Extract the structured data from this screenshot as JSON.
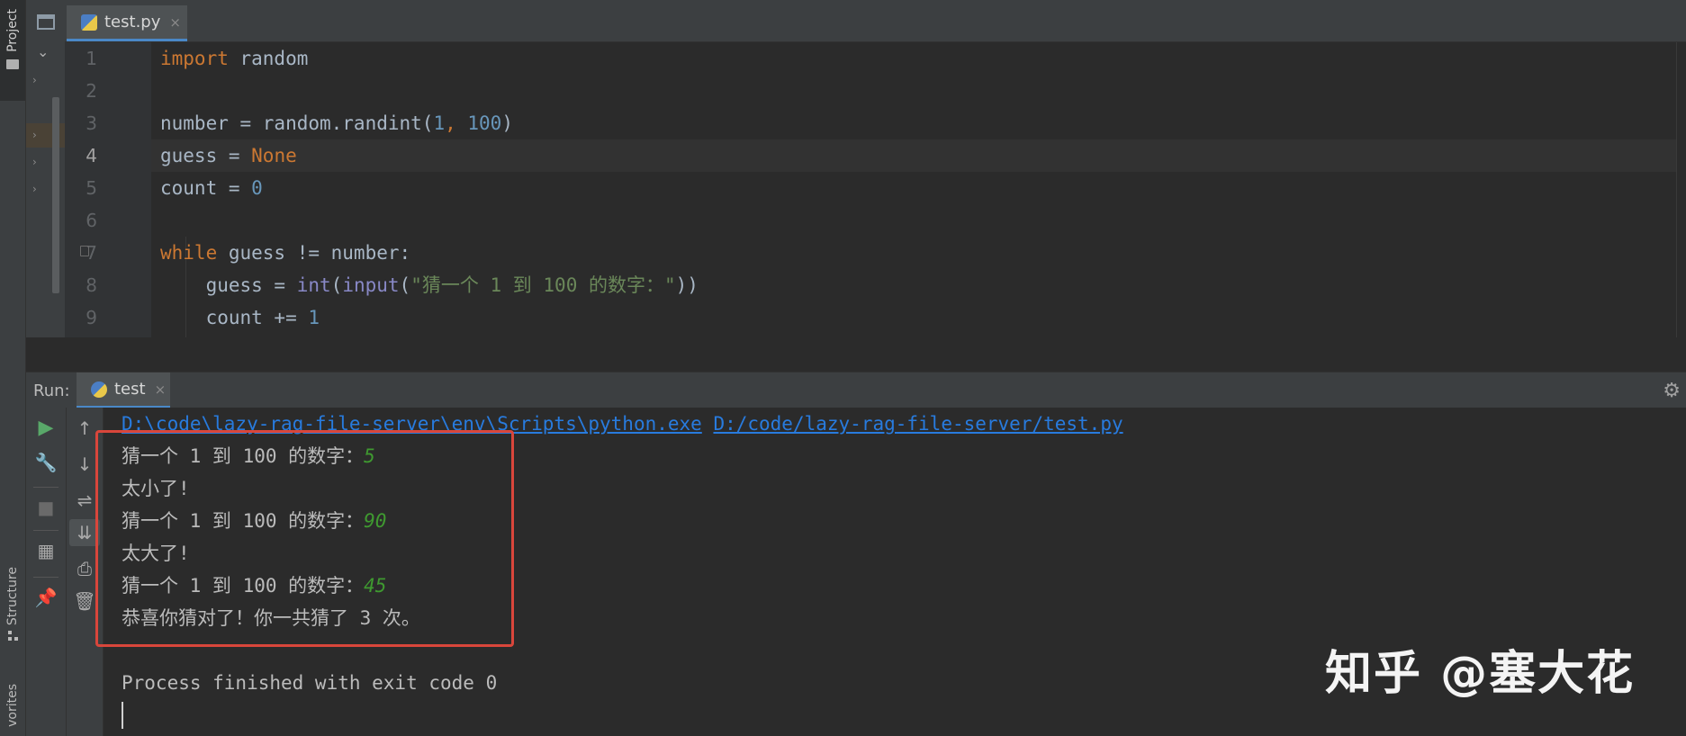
{
  "sidebar": {
    "project_label": "Project",
    "structure_label": "Structure",
    "favorites_label": "vorites"
  },
  "editor": {
    "tab": {
      "label": "test.py",
      "close": "×"
    },
    "line_numbers": [
      "1",
      "2",
      "3",
      "4",
      "5",
      "6",
      "7",
      "8",
      "9"
    ],
    "active_line": 4,
    "code": {
      "l1": {
        "kw": "import",
        "rest": " random"
      },
      "l3": {
        "a": "number = random.randint(",
        "n1": "1",
        "sep": ", ",
        "n2": "100",
        "b": ")"
      },
      "l4": {
        "a": "guess = ",
        "kw": "None"
      },
      "l5": {
        "a": "count = ",
        "n": "0"
      },
      "l7": {
        "kw": "while",
        "rest": " guess != number:"
      },
      "l8": {
        "indent": "    ",
        "a": "guess = ",
        "f1": "int",
        "p1": "(",
        "f2": "input",
        "p2": "(",
        "s": "\"猜一个 1 到 100 的数字：\"",
        "b": "))"
      },
      "l9": {
        "indent": "    ",
        "a": "count += ",
        "n": "1"
      }
    }
  },
  "run": {
    "label": "Run:",
    "tab_label": "test",
    "tab_close": "×",
    "console": {
      "cmd_exe": "D:\\code\\lazy-rag-file-server\\env\\Scripts\\python.exe",
      "cmd_space": " ",
      "cmd_script": "D:/code/lazy-rag-file-server/test.py",
      "lines": [
        {
          "prompt": "猜一个 1 到 100 的数字：",
          "input": "5"
        },
        {
          "text": "太小了!"
        },
        {
          "prompt": "猜一个 1 到 100 的数字：",
          "input": "90"
        },
        {
          "text": "太大了!"
        },
        {
          "prompt": "猜一个 1 到 100 的数字：",
          "input": "45"
        },
        {
          "text": "恭喜你猜对了！你一共猜了 3 次。"
        }
      ],
      "exit_message": "Process finished with exit code 0"
    }
  },
  "watermark": "知乎 @塞大花",
  "colors": {
    "keyword": "#cc7832",
    "number": "#6897bb",
    "string": "#6a8759",
    "builtin": "#8888c6",
    "link": "#287bde",
    "user_input": "#3f9a30",
    "highlight_box": "#d9463b"
  }
}
